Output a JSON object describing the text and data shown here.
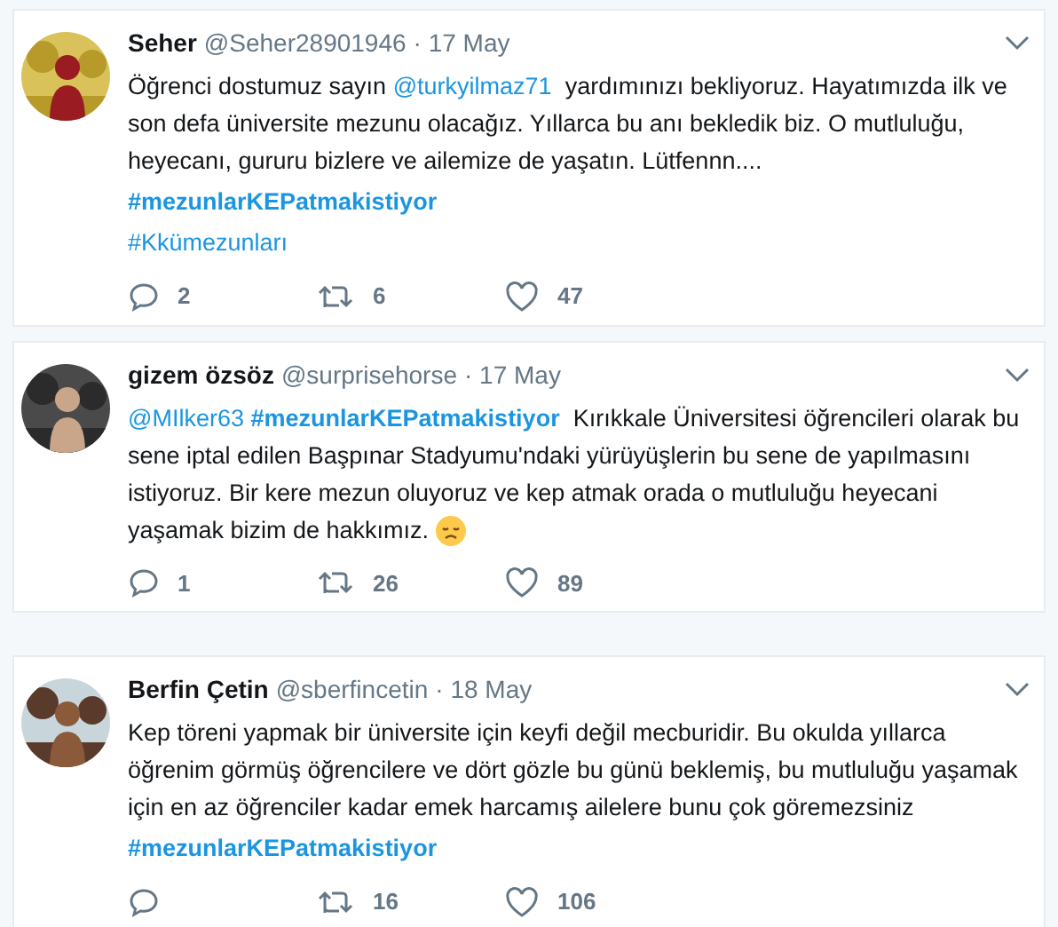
{
  "tweets": [
    {
      "name": "Seher",
      "handle": "@Seher28901946",
      "time": "· 17 May",
      "avatar": {
        "kind": "picture"
      },
      "paragraphs": [
        [
          {
            "kind": "text",
            "text": "Öğrenci dostumuz sayın "
          },
          {
            "kind": "link",
            "bold": false,
            "text": "@turkyilmaz71"
          },
          {
            "kind": "text",
            "text": "  yardımınızı bekliyoruz. Hayatımızda ilk ve son defa üniversite mezunu olacağız. Yıllarca bu anı bekledik biz. O mutluluğu, heyecanı, gururu bizlere ve ailemize de yaşatın. Lütfennn...."
          }
        ],
        [
          {
            "kind": "link",
            "bold": true,
            "text": "#mezunlarKEPatmakistiyor"
          }
        ],
        [
          {
            "kind": "link",
            "bold": false,
            "text": "#Kkümezunları"
          }
        ]
      ],
      "replies": "2",
      "retweets": "6",
      "likes": "47"
    },
    {
      "name": "gizem özsöz",
      "handle": "@surprisehorse",
      "time": "· 17 May",
      "avatar": {
        "kind": "picture"
      },
      "paragraphs": [
        [
          {
            "kind": "link",
            "bold": false,
            "text": "@MIlker63"
          },
          {
            "kind": "link",
            "bold": true,
            "text": "#mezunlarKEPatmakistiyor"
          },
          {
            "kind": "text",
            "text": "  Kırıkkale Üniversitesi öğrencileri olarak bu sene iptal edilen Başpınar Stadyumu'ndaki yürüyüşlerin bu sene de yapılmasını istiyoruz. Bir kere mezun oluyoruz ve kep atmak orada o mutluluğu heyecani yaşamak bizim de hakkımız. "
          },
          {
            "kind": "emoji"
          }
        ]
      ],
      "replies": "1",
      "retweets": "26",
      "likes": "89"
    },
    {
      "name": "Berfin Çetin",
      "handle": "@sberfincetin",
      "time": "· 18 May",
      "avatar": {
        "kind": "picture"
      },
      "paragraphs": [
        [
          {
            "kind": "text",
            "text": "Kep töreni yapmak bir üniversite için keyfi değil mecburidir. Bu okulda yıllarca öğrenim görmüş öğrencilere ve dört gözle bu günü beklemiş, bu mutluluğu yaşamak için en az öğrenciler kadar emek harcamış ailelere bunu çok göremezsiniz"
          }
        ],
        [
          {
            "kind": "link",
            "bold": true,
            "text": "#mezunlarKEPatmakistiyor"
          }
        ]
      ],
      "retweets": "16",
      "likes": "106"
    }
  ]
}
